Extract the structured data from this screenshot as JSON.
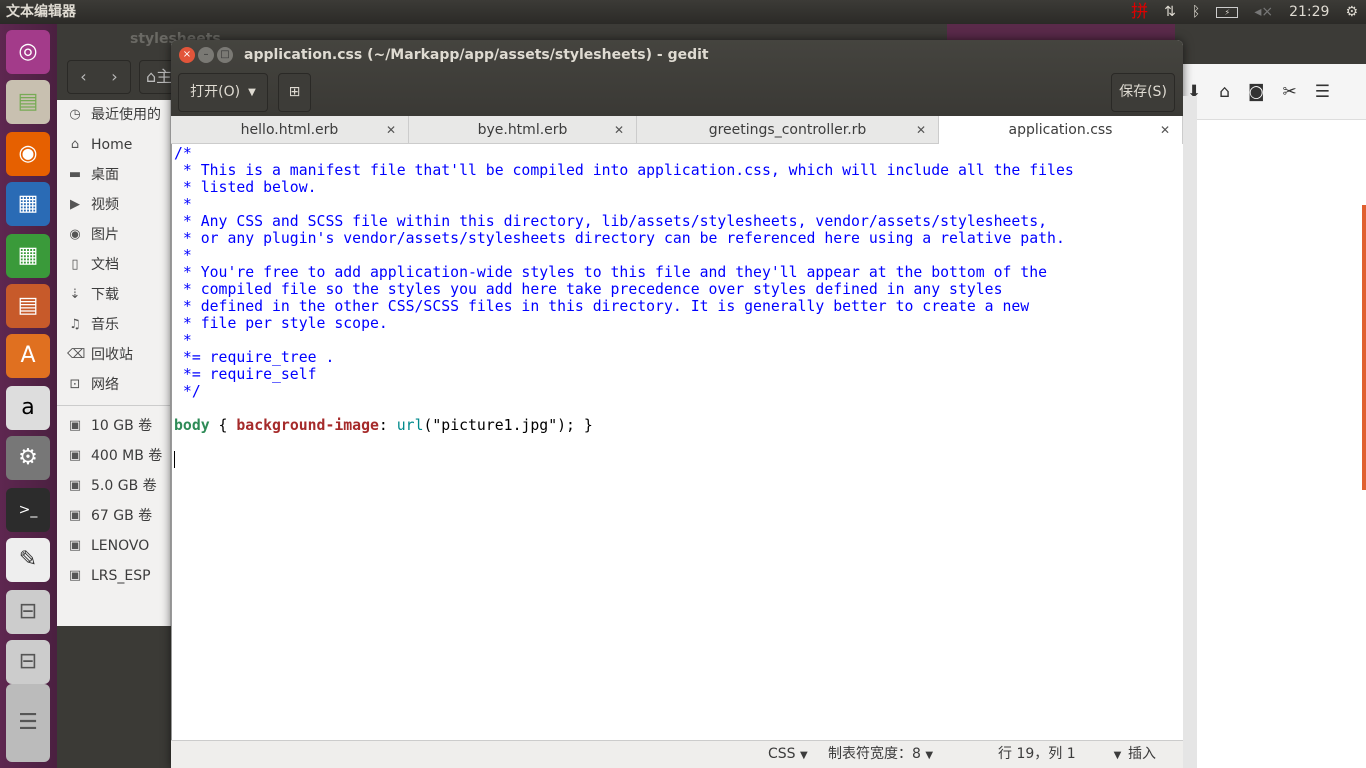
{
  "topbar": {
    "app_title": "文本编辑器",
    "input_method": "拼",
    "time": "21:29"
  },
  "file_manager": {
    "window_title": "stylesheets",
    "path_home": "主",
    "sidebar": [
      {
        "icon": "clock-icon",
        "label": "最近使用的"
      },
      {
        "icon": "home-icon",
        "label": "Home"
      },
      {
        "icon": "folder-icon",
        "label": "桌面"
      },
      {
        "icon": "video-icon",
        "label": "视频"
      },
      {
        "icon": "camera-icon",
        "label": "图片"
      },
      {
        "icon": "document-icon",
        "label": "文档"
      },
      {
        "icon": "download-icon",
        "label": "下载"
      },
      {
        "icon": "music-icon",
        "label": "音乐"
      },
      {
        "icon": "trash-icon",
        "label": "回收站"
      },
      {
        "icon": "network-icon",
        "label": "网络"
      },
      {
        "icon": "drive-icon",
        "label": "10 GB 卷"
      },
      {
        "icon": "drive-icon",
        "label": "400 MB 卷"
      },
      {
        "icon": "drive-icon",
        "label": "5.0 GB 卷"
      },
      {
        "icon": "drive-icon",
        "label": "67 GB 卷"
      },
      {
        "icon": "drive-icon",
        "label": "LENOVO"
      },
      {
        "icon": "drive-icon",
        "label": "LRS_ESP"
      }
    ]
  },
  "gedit": {
    "window_title": "application.css (~/Markapp/app/assets/stylesheets) - gedit",
    "open_label": "打开(O)",
    "save_label": "保存(S)",
    "tabs": [
      {
        "label": "hello.html.erb",
        "active": false
      },
      {
        "label": "bye.html.erb",
        "active": false
      },
      {
        "label": "greetings_controller.rb",
        "active": false
      },
      {
        "label": "application.css",
        "active": true
      }
    ],
    "comment": "/*\n * This is a manifest file that'll be compiled into application.css, which will include all the files\n * listed below.\n *\n * Any CSS and SCSS file within this directory, lib/assets/stylesheets, vendor/assets/stylesheets,\n * or any plugin's vendor/assets/stylesheets directory can be referenced here using a relative path.\n *\n * You're free to add application-wide styles to this file and they'll appear at the bottom of the\n * compiled file so the styles you add here take precedence over styles defined in any styles\n * defined in the other CSS/SCSS files in this directory. It is generally better to create a new\n * file per style scope.\n *\n *= require_tree .\n *= require_self\n */",
    "code_selector": "body",
    "code_open": " { ",
    "code_property": "background-image",
    "code_colon": ": ",
    "code_fn": "url",
    "code_value": "(\"picture1.jpg\"); }",
    "status": {
      "language": "CSS",
      "tab_width": "制表符宽度：8",
      "position": "行 19，列 1",
      "mode": "插入"
    }
  },
  "colors": {
    "comment": "#0000ff",
    "selector": "#2e8b57",
    "property": "#a52a2a",
    "function": "#008a8c",
    "launcher": "#5e2750"
  }
}
